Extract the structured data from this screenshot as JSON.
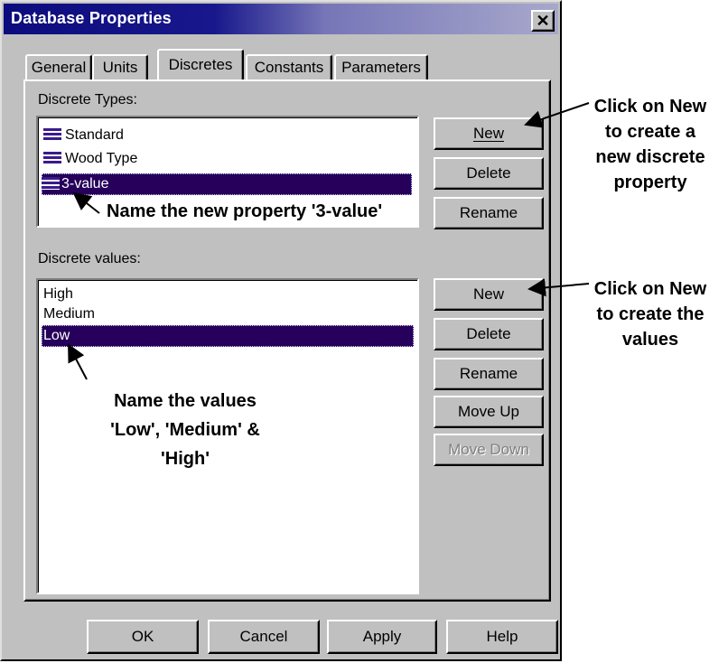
{
  "dialog": {
    "title": "Database Properties",
    "close_symbol": "✕"
  },
  "tabs": [
    {
      "label": "General",
      "active": false
    },
    {
      "label": "Units",
      "active": false
    },
    {
      "label": "Discretes",
      "active": true
    },
    {
      "label": "Constants",
      "active": false
    },
    {
      "label": "Parameters",
      "active": false
    }
  ],
  "discrete_types": {
    "label": "Discrete Types:",
    "items": [
      "Standard",
      "Wood Type",
      "3-value"
    ],
    "selected": "3-value",
    "item_icon": "discrete-type-icon",
    "buttons": {
      "new": "New",
      "delete": "Delete",
      "rename": "Rename"
    }
  },
  "discrete_values": {
    "label": "Discrete values:",
    "items": [
      "High",
      "Medium",
      "Low"
    ],
    "selected": "Low",
    "buttons": {
      "new": "New",
      "delete": "Delete",
      "rename": "Rename",
      "move_up": "Move Up",
      "move_down": "Move Down"
    }
  },
  "footer": {
    "ok": "OK",
    "cancel": "Cancel",
    "apply": "Apply",
    "help": "Help"
  },
  "annotations": {
    "new_types": [
      "Click on New",
      "to create a",
      "new discrete",
      "property"
    ],
    "name_property": "Name the new property '3-value'",
    "new_values": [
      "Click on New",
      "to create the",
      "values"
    ],
    "name_values": [
      "Name the values",
      "'Low', 'Medium' &",
      "'High'"
    ]
  },
  "colors": {
    "selection": "#26005a",
    "title_gradient_start": "#0c0c7e",
    "dialog_face": "#c0c0c0"
  }
}
